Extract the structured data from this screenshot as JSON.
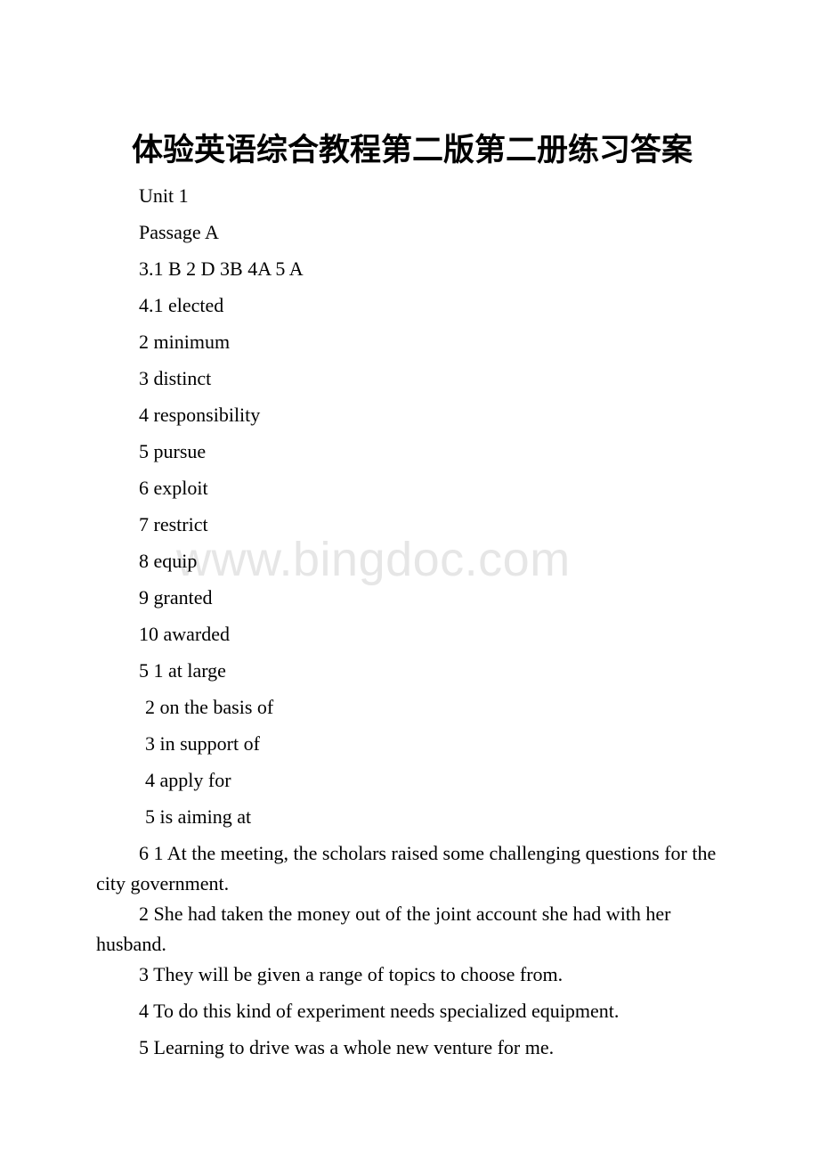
{
  "document": {
    "title": "体验英语综合教程第二版第二册练习答案",
    "watermark": "www.bingdoc.com"
  },
  "sections": {
    "unit": "Unit 1",
    "passage": "Passage A",
    "multiple_choice": "3.1 B 2 D 3B 4A 5 A"
  },
  "vocabulary": {
    "heading_item": "4.1 elected",
    "items": [
      "2 minimum",
      "3 distinct",
      "4 responsibility",
      "5 pursue",
      "6 exploit",
      "7 restrict",
      "8 equip",
      "9 granted",
      "10 awarded"
    ]
  },
  "phrases": {
    "heading_item": "5 1 at large",
    "items": [
      "2 on the basis of",
      "3 in support of",
      "4 apply for",
      "5 is aiming at"
    ]
  },
  "sentences": {
    "items": [
      "6 1 At the meeting, the scholars raised some challenging questions for the city government.",
      "2 She had taken the money out of the joint account she had with her husband.",
      "3 They will be given a range of topics to choose from.",
      "4 To do this kind of experiment needs specialized equipment.",
      "5 Learning to drive was a whole new venture for me."
    ]
  }
}
